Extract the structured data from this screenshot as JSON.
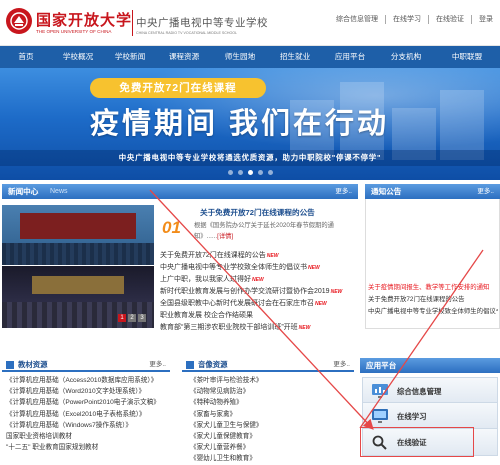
{
  "header": {
    "logo_cn": "国家开放大学",
    "logo_en": "THE OPEN UNIVERSITY OF CHINA",
    "school_cn": "中央广播电视中等专业学校",
    "school_en": "CHINA CENTRAL RADIO TV VOCATIONAL MIDDLE SCHOOL",
    "top_links": [
      "综合信息管理",
      "在线学习",
      "在线验证",
      "登录"
    ]
  },
  "nav": {
    "items": [
      "首页",
      "学校概况",
      "学校新闻",
      "课程资源",
      "师生园地",
      "招生就业",
      "应用平台",
      "分支机构",
      "中职联盟"
    ]
  },
  "banner": {
    "pill": "免费开放72门在线课程",
    "slogan": "疫情期间  我们在行动",
    "subslogan": "中央广播电视中等专业学校将通选优质资源，助力中职院校\"停课不停学\""
  },
  "news": {
    "title": "新闻中心",
    "subtitle": "News",
    "more": "更多..",
    "headline_num": "01",
    "headline_title": "关于免费开放72门在线课程的公告",
    "headline_desc": "根据《国务院办公厅关于延长2020年春节假期的通知》......",
    "headline_more": "[详情]",
    "items": [
      {
        "text": "关于免费开放72门在线课程的公告",
        "new": true
      },
      {
        "text": "中央广播电视中等专业学校致全体师生的倡议书",
        "new": true
      },
      {
        "text": "上广中职，我以我家人过得好",
        "new": true
      },
      {
        "text": "新时代职业教育发展与创作办学交流研讨暨协作会2019",
        "new": true
      },
      {
        "text": "全国县级职教中心新时代发展研讨会在石家庄市召",
        "new": true
      },
      {
        "text": "职业教育发展 校企合作结硕果",
        "new": false
      },
      {
        "text": "教育部“第三期涉农职业院校干部培训班”开班",
        "new": true
      }
    ],
    "pager": [
      "1",
      "2",
      "3"
    ]
  },
  "notice": {
    "title": "通知公告",
    "more": "更多..",
    "items": [
      "关于疫情期间报生、教学等工作安排的通知",
      "关于免费开放72门在线课程的公告",
      "中央广播电视中等专业学校致全体师生的倡议书"
    ]
  },
  "teaching": {
    "title": "教材资源",
    "more": "更多..",
    "items": [
      "《计算机应用基础（Access2010数据库应用系统）》",
      "《计算机应用基础（Word2010文字处理系统）》",
      "《计算机应用基础（PowerPoint2010电子演示文稿》",
      "《计算机应用基础（Excel2010电子表格系统）》",
      "《计算机应用基础（Windows7操作系统）》",
      "国家职业资格培训教材",
      "\"十二五\" 职业教育国家规划教材"
    ]
  },
  "audio": {
    "title": "音像资源",
    "more": "更多..",
    "items": [
      "《茶叶审评与检验技术》",
      "《动物常见病防治》",
      "《特种动物养殖》",
      "《家畜与家禽》",
      "《家犬儿童卫生与保健》",
      "《家犬儿童保健教育》",
      "《家犬儿童营养餐》",
      "《婴幼儿卫生和教育》"
    ]
  },
  "app_platform": {
    "title": "应用平台",
    "buttons": [
      "综合信息管理",
      "在线学习",
      "在线验证"
    ]
  },
  "colors": {
    "brand_red": "#c8161d",
    "nav_blue": "#1e5fa8",
    "section_blue": "#2c6fc0",
    "annotation_red": "#e54848"
  }
}
